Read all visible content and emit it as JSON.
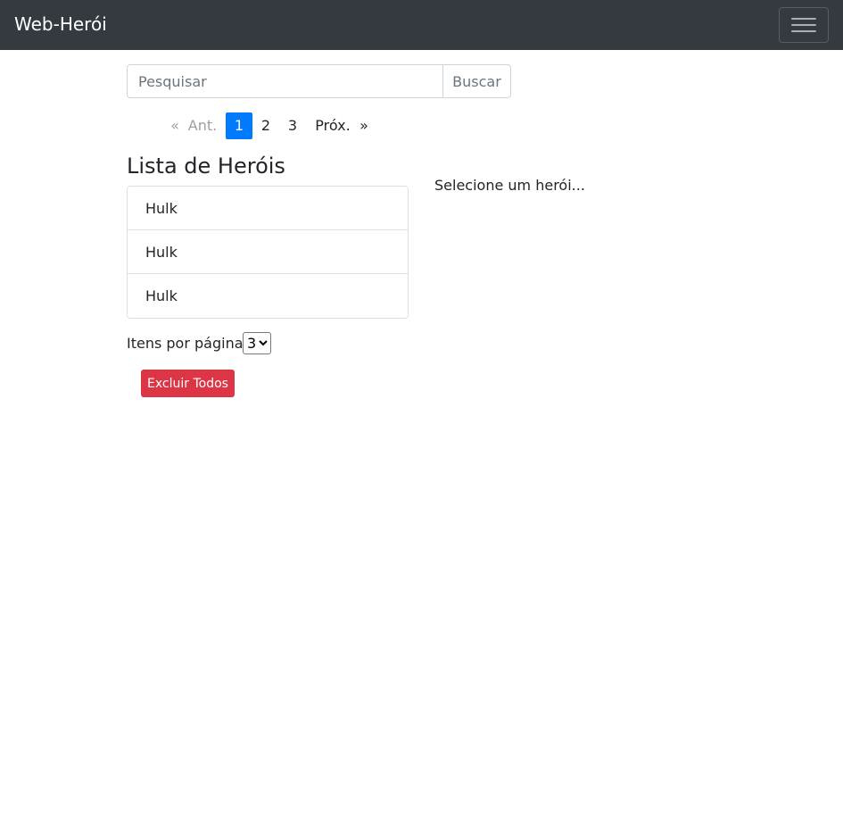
{
  "navbar": {
    "brand": "Web-Herói",
    "toggler_icon": "hamburger-icon"
  },
  "search": {
    "placeholder": "Pesquisar",
    "value": "",
    "button_label": "Buscar"
  },
  "pagination": {
    "first": "«",
    "prev": "Ant.",
    "pages": [
      "1",
      "2",
      "3"
    ],
    "current_page": "1",
    "next": "Próx.",
    "last": "»"
  },
  "hero_list": {
    "title": "Lista de Heróis",
    "items": [
      "Hulk",
      "Hulk",
      "Hulk"
    ]
  },
  "detail": {
    "empty_text": "Selecione um herói..."
  },
  "per_page": {
    "label": "Itens por página:",
    "selected": "3"
  },
  "actions": {
    "delete_all_label": "Excluir Todos"
  },
  "colors": {
    "navbar_bg": "#343a40",
    "accent": "#007bff",
    "danger": "#dc3545"
  }
}
